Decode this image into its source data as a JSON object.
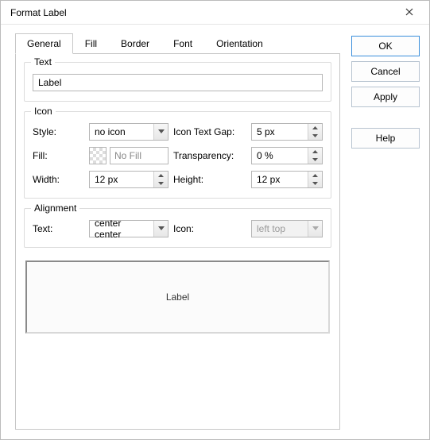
{
  "window": {
    "title": "Format Label"
  },
  "buttons": {
    "ok": "OK",
    "cancel": "Cancel",
    "apply": "Apply",
    "help": "Help"
  },
  "tabs": {
    "general": "General",
    "fill": "Fill",
    "border": "Border",
    "font": "Font",
    "orientation": "Orientation"
  },
  "groups": {
    "text": {
      "legend": "Text",
      "value": "Label"
    },
    "icon": {
      "legend": "Icon",
      "style_label": "Style:",
      "style_value": "no icon",
      "gap_label": "Icon Text Gap:",
      "gap_value": "5 px",
      "fill_label": "Fill:",
      "fill_value": "No Fill",
      "trans_label": "Transparency:",
      "trans_value": "0 %",
      "width_label": "Width:",
      "width_value": "12 px",
      "height_label": "Height:",
      "height_value": "12 px"
    },
    "alignment": {
      "legend": "Alignment",
      "text_label": "Text:",
      "text_value": "center center",
      "icon_label": "Icon:",
      "icon_value": "left top"
    }
  },
  "preview": {
    "text": "Label"
  }
}
